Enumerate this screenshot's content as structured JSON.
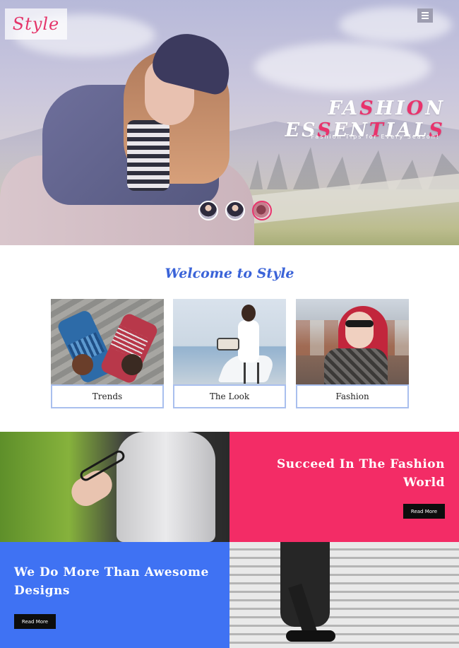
{
  "header": {
    "logo_text": "Style",
    "menu_icon": "hamburger-icon"
  },
  "hero": {
    "title_parts": [
      {
        "text": "FA",
        "accent": false
      },
      {
        "text": "S",
        "accent": true
      },
      {
        "text": "HI",
        "accent": false
      },
      {
        "text": "O",
        "accent": true
      },
      {
        "text": "N ES",
        "accent": false
      },
      {
        "text": "S",
        "accent": true
      },
      {
        "text": "EN",
        "accent": false
      },
      {
        "text": "T",
        "accent": true
      },
      {
        "text": "IAL",
        "accent": false
      },
      {
        "text": "S",
        "accent": true
      }
    ],
    "subtitle": "Fashion Tips for Every Season!",
    "slider_thumbs": [
      "thumb-1",
      "thumb-2",
      "thumb-3"
    ],
    "active_thumb": 3
  },
  "welcome": {
    "title": "Welcome to Style",
    "cards": [
      {
        "label": "Trends"
      },
      {
        "label": "The Look"
      },
      {
        "label": "Fashion"
      }
    ]
  },
  "features": {
    "pink_heading": "Succeed In The Fashion World",
    "pink_button": "Read More",
    "blue_heading": "We Do More Than Awesome Designs",
    "blue_button": "Read More"
  },
  "colors": {
    "accent_pink": "#f32c66",
    "accent_blue": "#3f72f3",
    "welcome_blue": "#3a63d8",
    "button_dark": "#0d0d0d"
  }
}
